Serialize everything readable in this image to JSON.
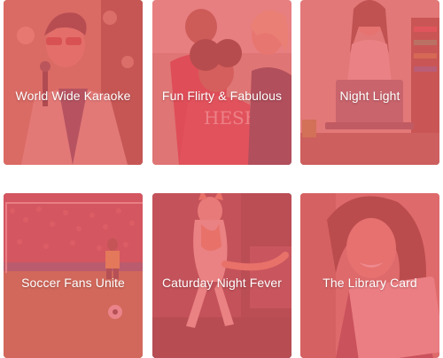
{
  "tiles": [
    {
      "title": "World Wide Karaoke",
      "icon": "karaoke-singer-image"
    },
    {
      "title": "Fun Flirty & Fabulous",
      "icon": "friends-laughing-image"
    },
    {
      "title": "Night Light",
      "icon": "woman-laptop-image"
    },
    {
      "title": "Soccer Fans Unite",
      "icon": "soccer-stadium-image"
    },
    {
      "title": "Caturday Night Fever",
      "icon": "dancing-cat-image"
    },
    {
      "title": "The Library Card",
      "icon": "woman-reading-image"
    }
  ],
  "colors": {
    "overlay": "#E85C64",
    "label": "#FFFFFF"
  }
}
